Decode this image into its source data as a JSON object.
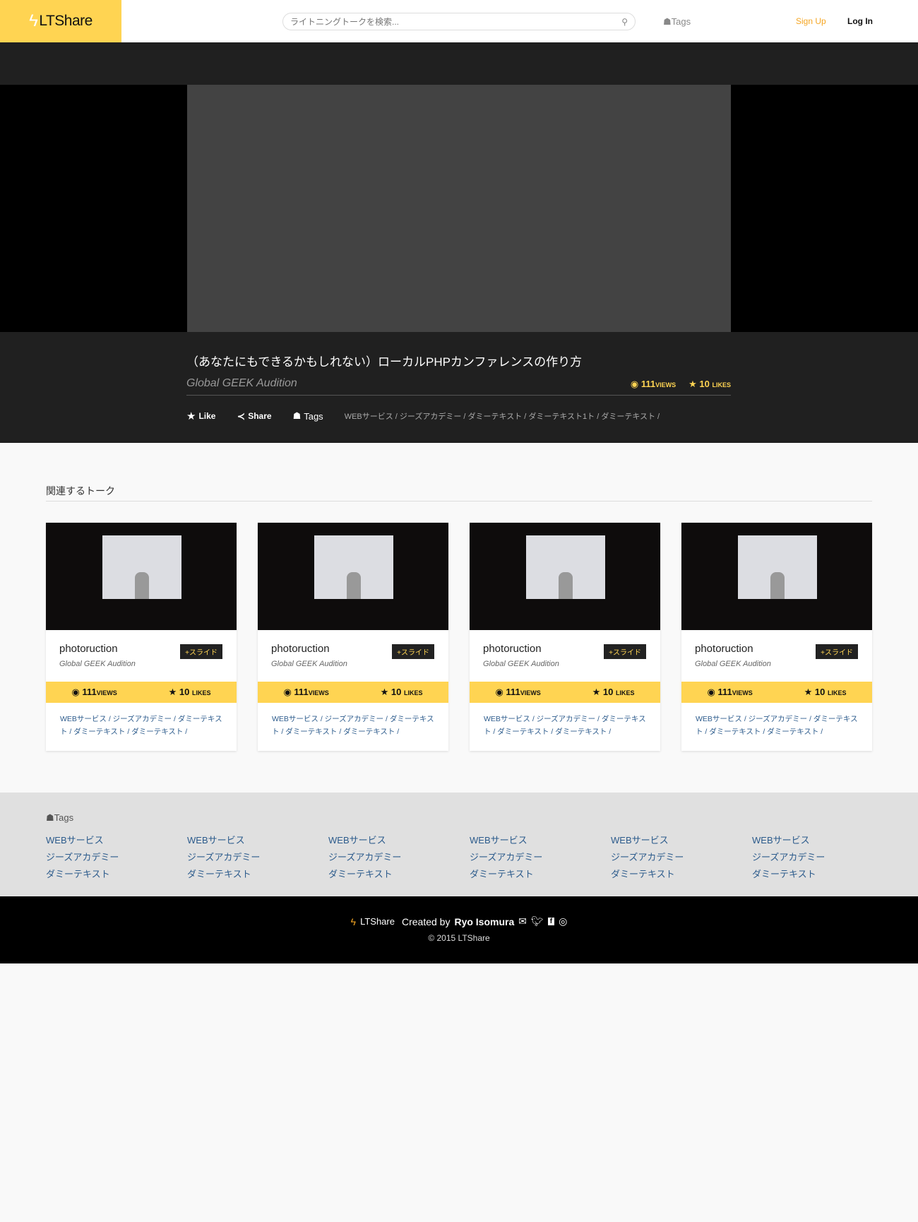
{
  "header": {
    "logo": "LTShare",
    "search_placeholder": "ライトニングトークを検索...",
    "tags": "Tags",
    "signup": "Sign Up",
    "login": "Log In"
  },
  "talk": {
    "title": "（あなたにもできるかもしれない）ローカルPHPカンファレンスの作り方",
    "author": "Global GEEK Audition",
    "views": "111",
    "views_label": "VIEWS",
    "likes": "10",
    "likes_label": "LIKES",
    "like_btn": "Like",
    "share_btn": "Share",
    "tags_btn": "Tags",
    "tags": "WEBサービス / ジーズアカデミー / ダミーテキスト / ダミーテキスト1ト / ダミーテキスト /"
  },
  "related": {
    "heading": "関連するトーク",
    "cards": [
      {
        "name": "photoruction",
        "author": "Global GEEK Audition",
        "badge": "+スライド",
        "views": "111",
        "views_label": "VIEWS",
        "likes": "10",
        "likes_label": "LIKES",
        "tags": "WEBサービス / ジーズアカデミー / ダミーテキスト / ダミーテキスト / ダミーテキスト /"
      },
      {
        "name": "photoruction",
        "author": "Global GEEK Audition",
        "badge": "+スライド",
        "views": "111",
        "views_label": "VIEWS",
        "likes": "10",
        "likes_label": "LIKES",
        "tags": "WEBサービス / ジーズアカデミー / ダミーテキスト / ダミーテキスト / ダミーテキスト /"
      },
      {
        "name": "photoruction",
        "author": "Global GEEK Audition",
        "badge": "+スライド",
        "views": "111",
        "views_label": "VIEWS",
        "likes": "10",
        "likes_label": "LIKES",
        "tags": "WEBサービス / ジーズアカデミー / ダミーテキスト / ダミーテキスト / ダミーテキスト /"
      },
      {
        "name": "photoruction",
        "author": "Global GEEK Audition",
        "badge": "+スライド",
        "views": "111",
        "views_label": "VIEWS",
        "likes": "10",
        "likes_label": "LIKES",
        "tags": "WEBサービス / ジーズアカデミー / ダミーテキスト / ダミーテキスト / ダミーテキスト /"
      }
    ]
  },
  "footer_tags": {
    "heading": "Tags",
    "columns": [
      [
        "WEBサービス",
        "ジーズアカデミー",
        "ダミーテキスト"
      ],
      [
        "WEBサービス",
        "ジーズアカデミー",
        "ダミーテキスト"
      ],
      [
        "WEBサービス",
        "ジーズアカデミー",
        "ダミーテキスト"
      ],
      [
        "WEBサービス",
        "ジーズアカデミー",
        "ダミーテキスト"
      ],
      [
        "WEBサービス",
        "ジーズアカデミー",
        "ダミーテキスト"
      ],
      [
        "WEBサービス",
        "ジーズアカデミー",
        "ダミーテキスト"
      ]
    ]
  },
  "footer": {
    "logo": "LTShare",
    "created_by": "Created by",
    "author": "Ryo Isomura",
    "copyright": "© 2015 LTShare"
  }
}
